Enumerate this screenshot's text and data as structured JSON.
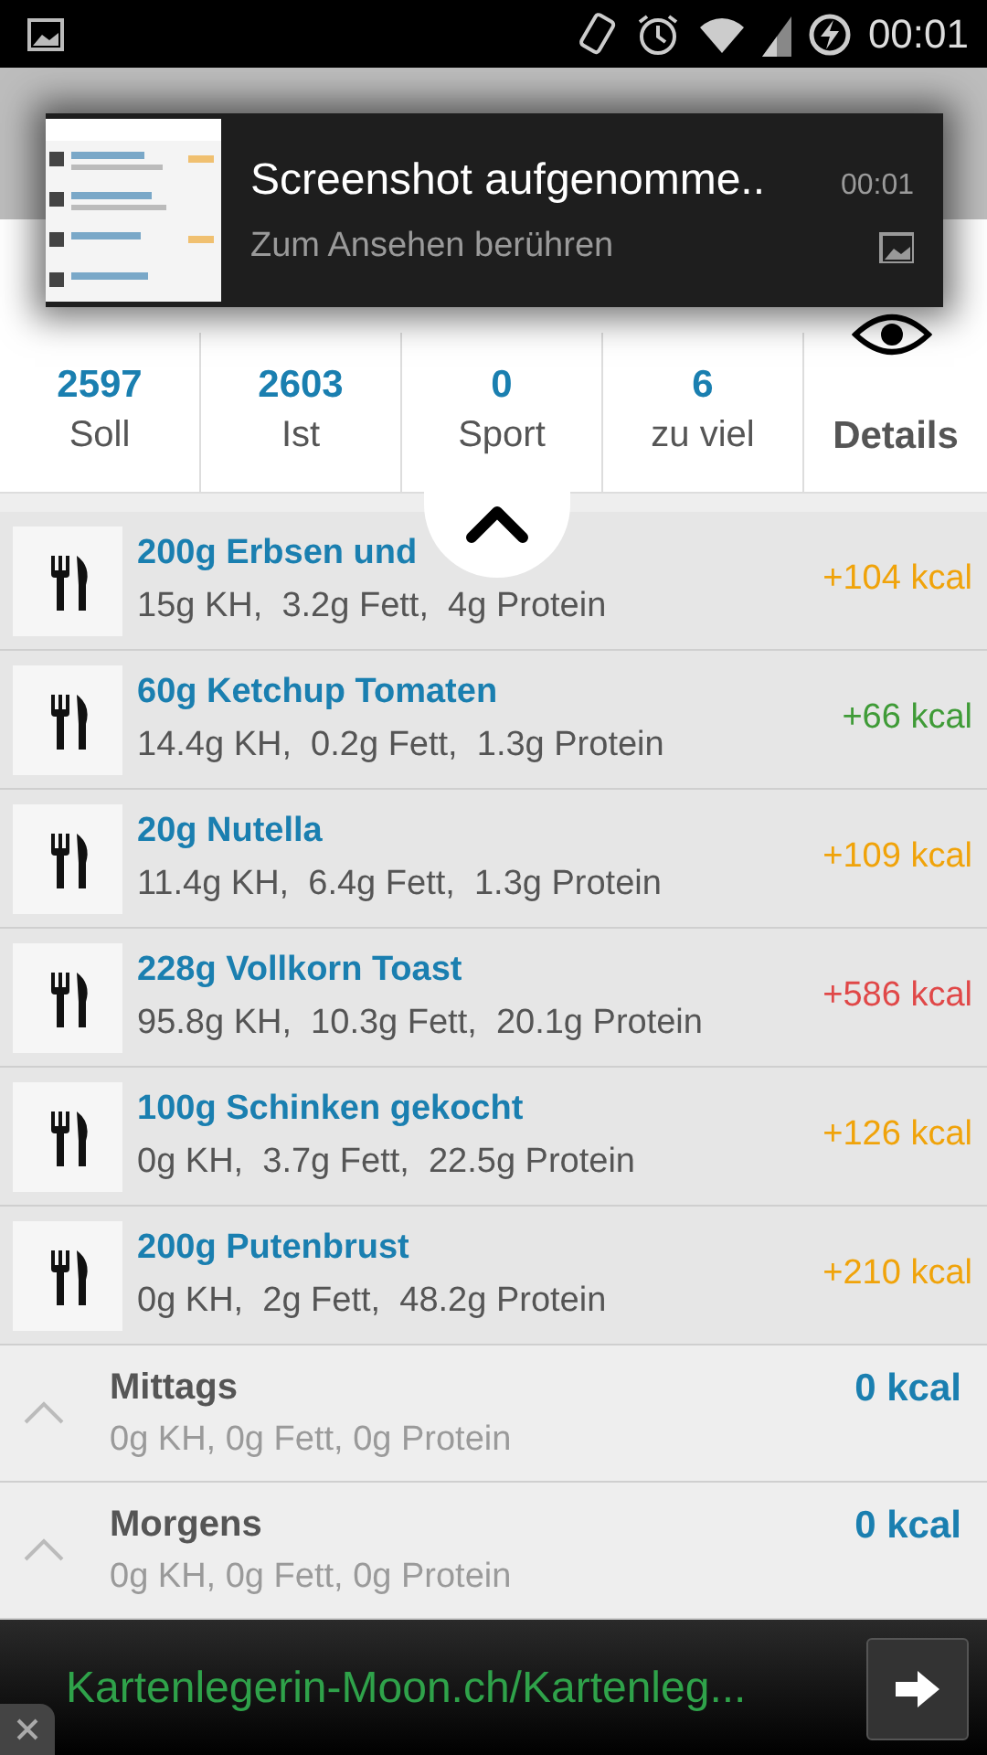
{
  "status_bar": {
    "time": "00:01"
  },
  "notification": {
    "title": "Screenshot aufgenomme..",
    "time": "00:01",
    "text": "Zum Ansehen berühren"
  },
  "summary": [
    {
      "value": "2597",
      "label": "Soll"
    },
    {
      "value": "2603",
      "label": "Ist"
    },
    {
      "value": "0",
      "label": "Sport"
    },
    {
      "value": "6",
      "label": "zu viel"
    }
  ],
  "details_button": "Details",
  "foods": [
    {
      "name": "200g Erbsen und",
      "macros": "15g KH,  3.2g Fett,  4g Protein",
      "kcal": "+104 kcal",
      "color": "#f0a30a"
    },
    {
      "name": "60g Ketchup Tomaten",
      "macros": "14.4g KH,  0.2g Fett,  1.3g Protein",
      "kcal": "+66 kcal",
      "color": "#3f9b37"
    },
    {
      "name": "20g Nutella",
      "macros": "11.4g KH,  6.4g Fett,  1.3g Protein",
      "kcal": "+109 kcal",
      "color": "#f0a30a"
    },
    {
      "name": "228g Vollkorn Toast",
      "macros": "95.8g KH,  10.3g Fett,  20.1g Protein",
      "kcal": "+586 kcal",
      "color": "#e04848"
    },
    {
      "name": "100g Schinken gekocht",
      "macros": "0g KH,  3.7g Fett,  22.5g Protein",
      "kcal": "+126 kcal",
      "color": "#f0a30a"
    },
    {
      "name": "200g Putenbrust",
      "macros": "0g KH,  2g Fett,  48.2g Protein",
      "kcal": "+210 kcal",
      "color": "#f0a30a"
    }
  ],
  "meals": [
    {
      "name": "Mittags",
      "macros": "0g KH, 0g Fett, 0g Protein",
      "kcal": "0 kcal",
      "expanded": false
    },
    {
      "name": "Morgens",
      "macros": "0g KH, 0g Fett, 0g Protein",
      "kcal": "0 kcal",
      "expanded": false
    }
  ],
  "ad": {
    "text": "Kartenlegerin-Moon.ch/Kartenleg..."
  }
}
